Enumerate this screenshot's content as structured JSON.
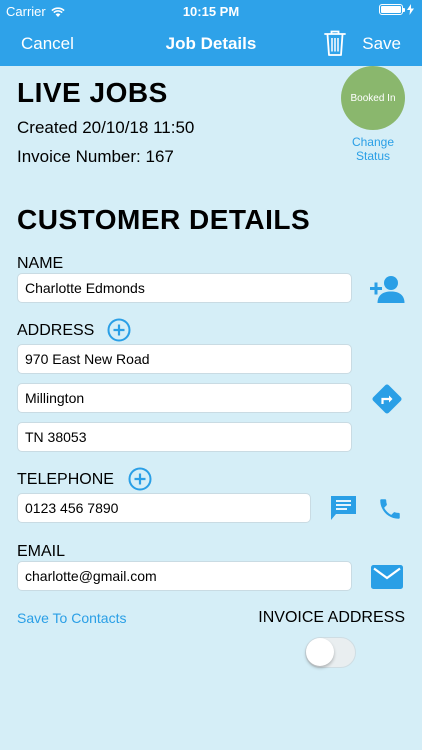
{
  "status_bar": {
    "carrier": "Carrier",
    "time": "10:15 PM"
  },
  "nav": {
    "cancel": "Cancel",
    "title": "Job Details",
    "save": "Save"
  },
  "job": {
    "heading": "LIVE JOBS",
    "created": "Created 20/10/18 11:50",
    "invoice_number": "Invoice Number: 167",
    "status_badge": "Booked In",
    "change_status": "Change Status"
  },
  "customer": {
    "heading": "CUSTOMER DETAILS",
    "name_label": "NAME",
    "name_value": "Charlotte Edmonds",
    "address_label": "ADDRESS",
    "address_line1": "970 East New Road",
    "address_line2": "Millington",
    "address_line3": "TN 38053",
    "telephone_label": "TELEPHONE",
    "telephone_value": "0123 456 7890",
    "email_label": "EMAIL",
    "email_value": "charlotte@gmail.com",
    "save_to_contacts": "Save To Contacts",
    "invoice_address_label": "INVOICE ADDRESS",
    "invoice_address_enabled": false
  },
  "colors": {
    "nav_bar": "#2ea2e9",
    "background": "#d5eef7",
    "accent_blue": "#2a9fe6",
    "status_green": "#8ab76d"
  },
  "icons": {
    "trash": "trash-icon",
    "add_contact": "person-add-icon",
    "directions": "directions-icon",
    "message": "message-icon",
    "phone": "phone-icon",
    "email": "envelope-icon",
    "add": "plus-circle-icon"
  }
}
